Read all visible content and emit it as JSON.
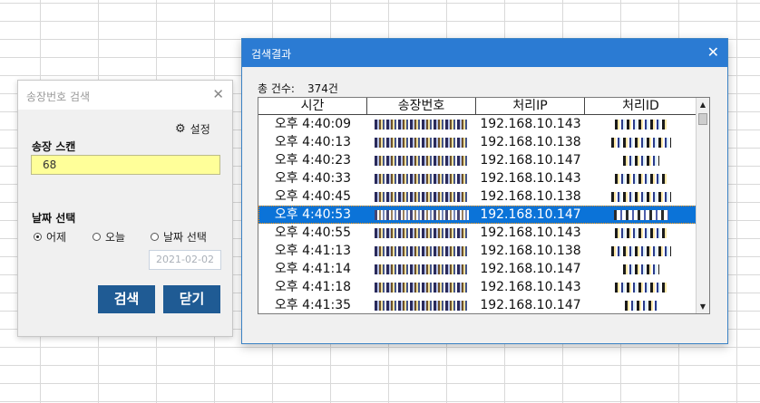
{
  "search_dialog": {
    "title": "송장번호 검색",
    "close_glyph": "✕",
    "settings_label": "설정",
    "scan_label": "송장 스캔",
    "scan_value": "68",
    "date_section_label": "날짜 선택",
    "radio_options": [
      {
        "label": "어제",
        "selected": true
      },
      {
        "label": "오늘",
        "selected": false
      },
      {
        "label": "날짜 선택",
        "selected": false
      }
    ],
    "date_value": "2021-02-02",
    "search_button": "검색",
    "close_button": "닫기",
    "accent_color": "#1f5b94",
    "input_bg_color": "#ffff99"
  },
  "results_dialog": {
    "title": "검색결과",
    "close_glyph": "✕",
    "count_label": "총 건수:",
    "count_value": "374건",
    "title_bar_color": "#2b7bd3",
    "selection_color": "#0b73d8",
    "columns": [
      "시간",
      "송장번호",
      "처리IP",
      "처리ID"
    ],
    "rows": [
      {
        "time": "오후 4:40:09",
        "ip": "192.168.10.143",
        "selected": false
      },
      {
        "time": "오후 4:40:13",
        "ip": "192.168.10.138",
        "selected": false
      },
      {
        "time": "오후 4:40:23",
        "ip": "192.168.10.147",
        "selected": false
      },
      {
        "time": "오후 4:40:33",
        "ip": "192.168.10.143",
        "selected": false
      },
      {
        "time": "오후 4:40:45",
        "ip": "192.168.10.138",
        "selected": false
      },
      {
        "time": "오후 4:40:53",
        "ip": "192.168.10.147",
        "selected": true
      },
      {
        "time": "오후 4:40:55",
        "ip": "192.168.10.143",
        "selected": false
      },
      {
        "time": "오후 4:41:13",
        "ip": "192.168.10.138",
        "selected": false
      },
      {
        "time": "오후 4:41:14",
        "ip": "192.168.10.147",
        "selected": false
      },
      {
        "time": "오후 4:41:18",
        "ip": "192.168.10.143",
        "selected": false
      },
      {
        "time": "오후 4:41:35",
        "ip": "192.168.10.147",
        "selected": false
      }
    ],
    "scroll_up_glyph": "▲",
    "scroll_down_glyph": "▼"
  }
}
